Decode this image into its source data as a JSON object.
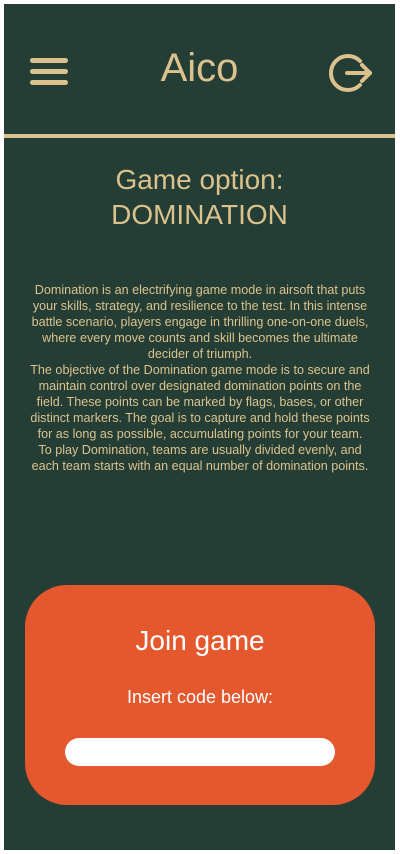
{
  "header": {
    "title": "Aico",
    "menu_icon": "hamburger-menu-icon",
    "logout_icon": "logout-icon"
  },
  "page": {
    "heading_line1": "Game option:",
    "heading_line2": "DOMINATION",
    "description": "Domination is an electrifying game mode in airsoft that puts your skills, strategy, and resilience to the test. In this intense battle scenario, players engage in thrilling one-on-one duels, where every move counts and skill becomes the ultimate decider of triumph.\nThe objective of the Domination game mode is to secure and maintain control over designated domination points on the field. These points can be marked by flags, bases, or other distinct markers. The goal is to capture and hold these points for as long as possible, accumulating points for your team.\nTo play Domination, teams are usually divided evenly, and each team starts with an equal number of domination points."
  },
  "join": {
    "title": "Join game",
    "subtitle": "Insert code below:",
    "code_value": "",
    "code_placeholder": ""
  },
  "colors": {
    "background": "#243d35",
    "accent": "#dbc28d",
    "card": "#e5582e"
  }
}
